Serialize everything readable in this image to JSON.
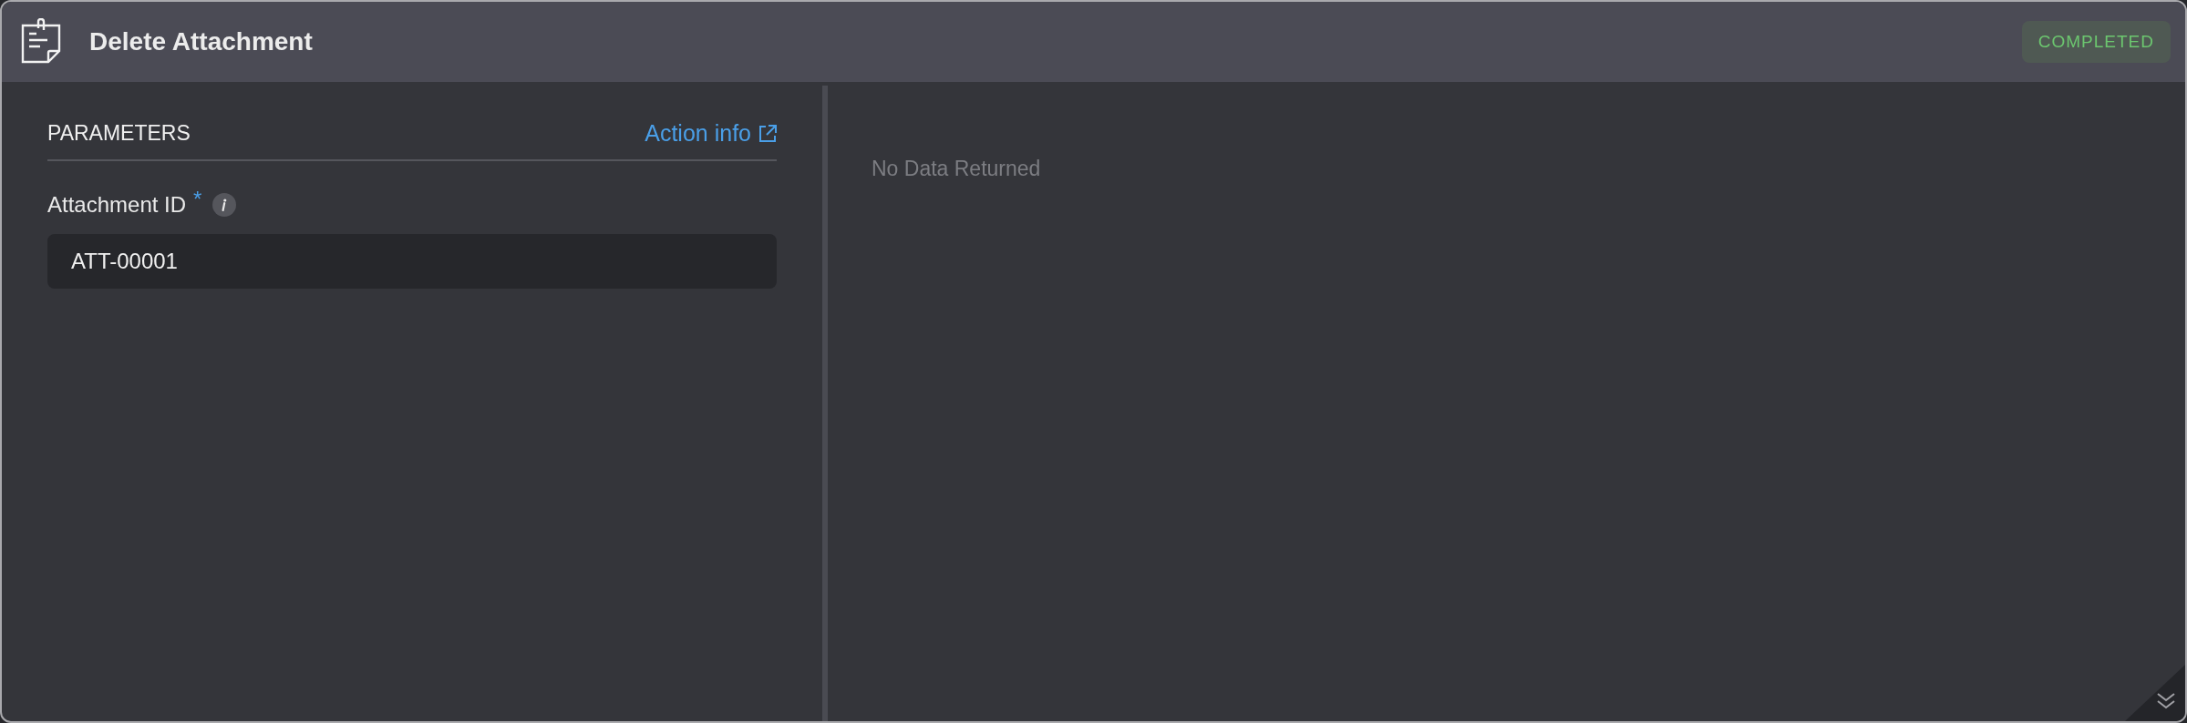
{
  "window": {
    "title": "Delete Attachment",
    "status": {
      "label": "COMPLETED",
      "kind": "success"
    }
  },
  "parameters": {
    "heading": "PARAMETERS",
    "link": "Action info",
    "fields": [
      {
        "label": "Attachment ID",
        "required_mark": "*",
        "value": "ATT-00001"
      }
    ]
  },
  "result": {
    "message": "No Data Returned"
  }
}
